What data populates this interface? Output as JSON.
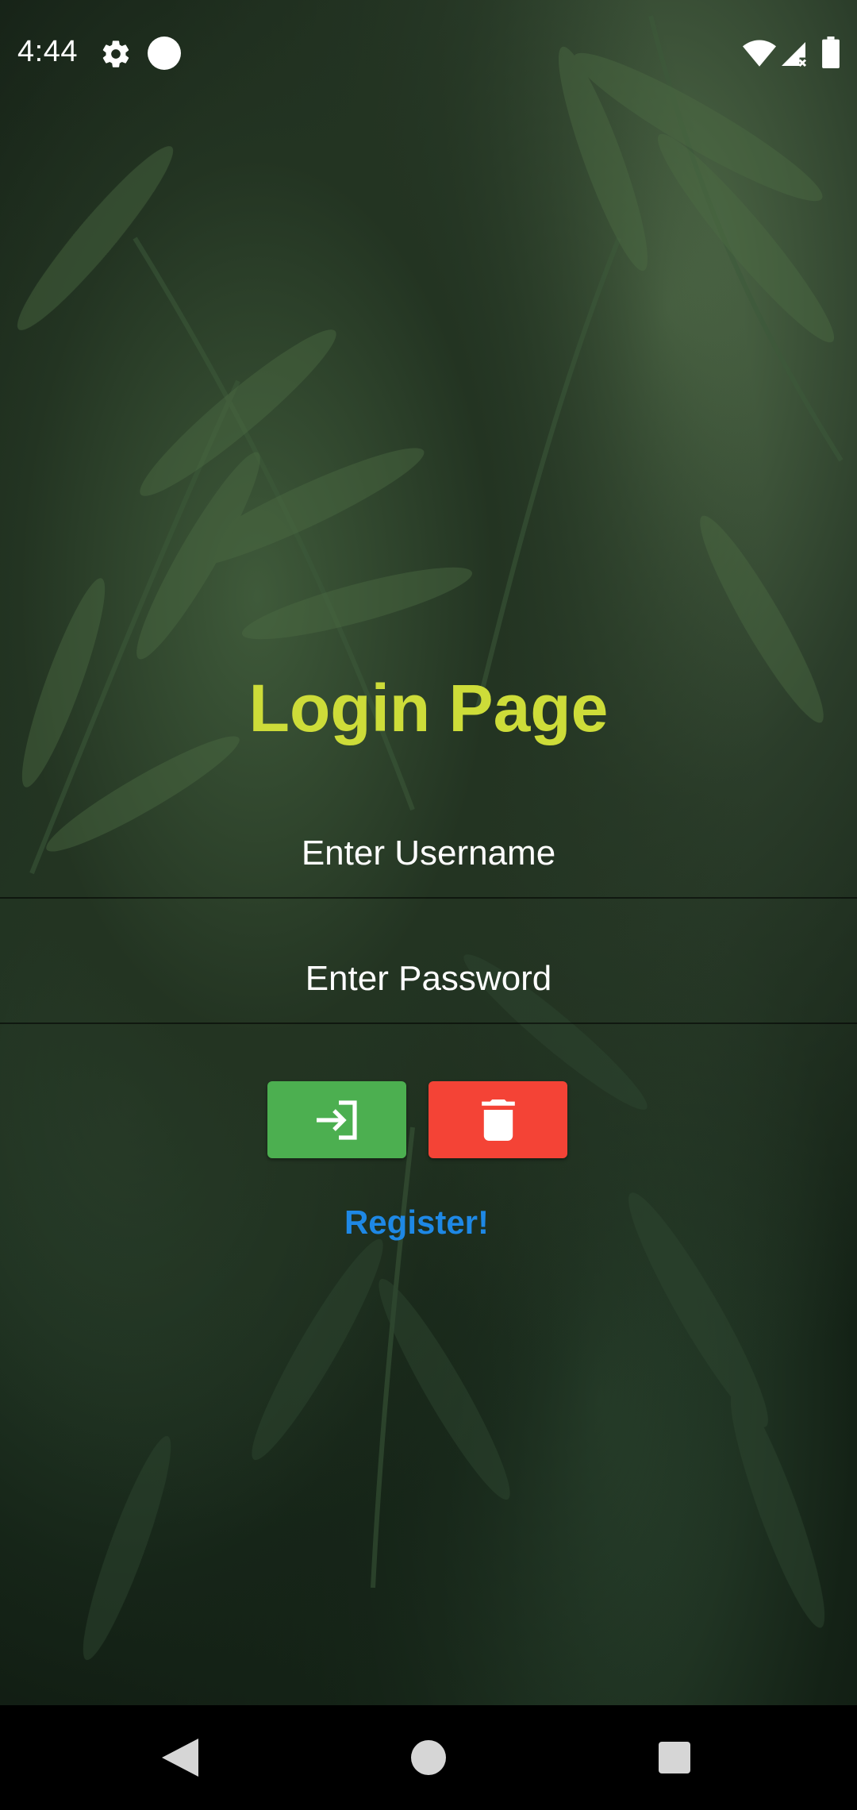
{
  "status_bar": {
    "time": "4:44",
    "icons": [
      "settings-gear-icon",
      "notification-dot-icon",
      "wifi-icon",
      "cell-signal-icon",
      "battery-icon"
    ]
  },
  "form": {
    "title": "Login Page",
    "username_placeholder": "Enter Username",
    "password_placeholder": "Enter Password",
    "login_icon": "login-enter-icon",
    "clear_icon": "trash-icon",
    "register_label": "Register!"
  },
  "colors": {
    "title": "#cddc39",
    "login_button": "#4caf50",
    "clear_button": "#f44336",
    "register_link": "#1e88e5"
  },
  "nav_bar": {
    "icons": [
      "back-triangle-icon",
      "home-circle-icon",
      "recents-square-icon"
    ]
  }
}
